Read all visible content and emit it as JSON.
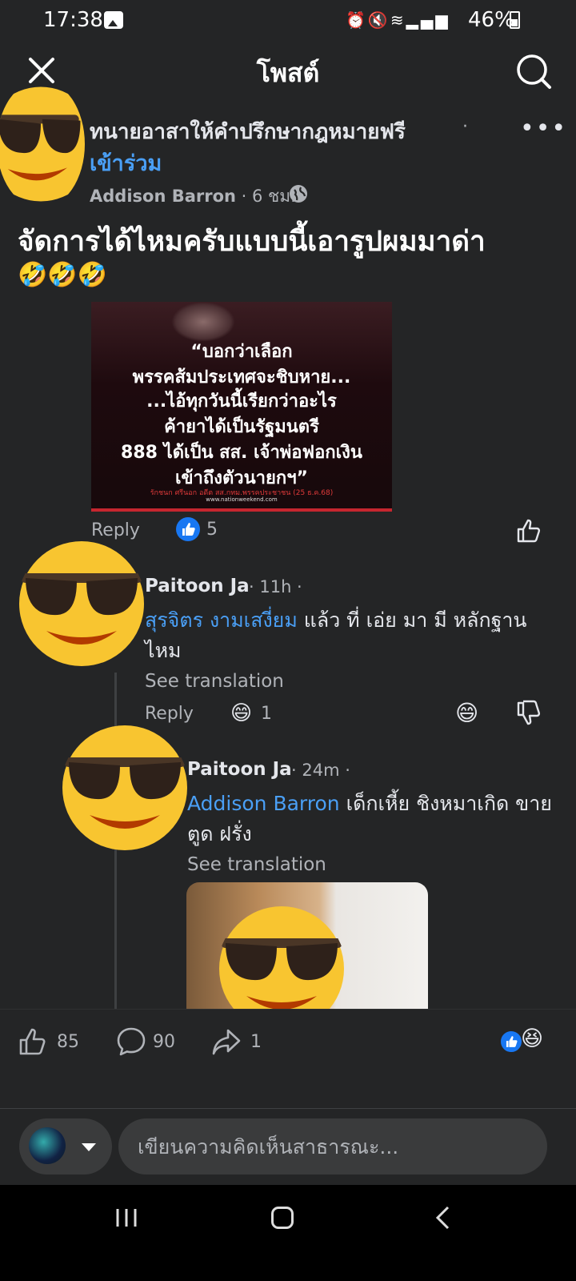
{
  "status_bar": {
    "time": "17:38",
    "battery": "46%",
    "icons": [
      "gallery-icon",
      "alarm-icon",
      "mute-icon",
      "wifi-icon",
      "volte-icon",
      "signal-icon",
      "battery-icon"
    ]
  },
  "header": {
    "title": "โพสต์",
    "close_icon": "close-icon",
    "search_icon": "search-icon"
  },
  "post": {
    "group_name": "ทนายอาสาให้คำปรึกษากฎหมายฟรี",
    "separator": "·",
    "join_label": "เข้าร่วม",
    "author": "Addison Barron",
    "time_meta": "· 6 ชม. ·",
    "text": "จัดการได้ไหมครับแบบนี้เอารูปผมมาด่า",
    "text_emojis": "🤣🤣🤣",
    "image_lines": [
      "“บอกว่าเลือก",
      "พรรคส้มประเทศจะชิบหาย...",
      "...ไอ้ทุกวันนี้เรียกว่าอะไร",
      "ค้ายาได้เป็นรัฐมนตรี",
      "888 ได้เป็น สส. เจ้าพ่อฟอกเงิน",
      "เข้าถึงตัวนายกฯ”"
    ],
    "image_caption": "รักชนก ศรีนอก อดีต สส.กทม.พรรคประชาชน (25 ธ.ค.68)",
    "image_url": "www.nationweekend.com",
    "reply_label": "Reply",
    "like_count": "5"
  },
  "comments": [
    {
      "name": "Paitoon Ja",
      "meta": "· 11h ·",
      "mention": "สุรจิตร งามเสงี่ยม",
      "text": " แล้ว ที่ เอ่ย มา มี หลักฐาน ไหม",
      "see_translation": "See translation",
      "reply_label": "Reply",
      "reaction_emoji": "😄",
      "reaction_count": "1",
      "react_button_emoji": "😄"
    },
    {
      "name": "Paitoon Ja",
      "meta": "· 24m ·",
      "mention": "Addison Barron",
      "text": " เด็กเหี้ย ชิงหมาเกิด ขายตูด ฝรั่ง",
      "see_translation": "See translation"
    }
  ],
  "engagement": {
    "likes": "85",
    "comments": "90",
    "shares": "1",
    "reaction_summary": [
      "like",
      "😆"
    ]
  },
  "comment_box": {
    "placeholder": "เขียนความคิดเห็นสาธารณะ..."
  },
  "avatar_emoji": "😎",
  "colors": {
    "background": "#242526",
    "link": "#4a9ff5",
    "like_blue": "#1877f2",
    "secondary_text": "#b0b3b8"
  }
}
